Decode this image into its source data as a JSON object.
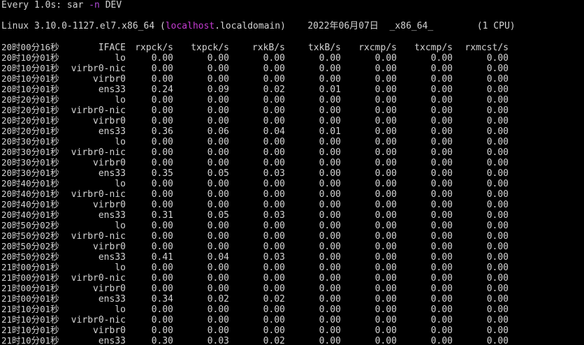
{
  "watch": {
    "prefix": "Every 1.0s: sar ",
    "flag": "-n",
    "suffix": " DEV"
  },
  "sysinfo": {
    "prefix": "Linux 3.10.0-1127.el7.x86_64 (",
    "host": "localhost",
    "suffix": ".localdomain)    2022年06月07日  _x86_64_        (1 CPU)"
  },
  "columns": [
    "20时00分16秒",
    "IFACE",
    "rxpck/s",
    "txpck/s",
    "rxkB/s",
    "txkB/s",
    "rxcmp/s",
    "txcmp/s",
    "rxmcst/s"
  ],
  "rows": [
    {
      "time": "20时10分01秒",
      "iface": "lo",
      "values": [
        "0.00",
        "0.00",
        "0.00",
        "0.00",
        "0.00",
        "0.00",
        "0.00"
      ]
    },
    {
      "time": "20时10分01秒",
      "iface": "virbr0-nic",
      "values": [
        "0.00",
        "0.00",
        "0.00",
        "0.00",
        "0.00",
        "0.00",
        "0.00"
      ]
    },
    {
      "time": "20时10分01秒",
      "iface": "virbr0",
      "values": [
        "0.00",
        "0.00",
        "0.00",
        "0.00",
        "0.00",
        "0.00",
        "0.00"
      ]
    },
    {
      "time": "20时10分01秒",
      "iface": "ens33",
      "values": [
        "0.24",
        "0.09",
        "0.02",
        "0.01",
        "0.00",
        "0.00",
        "0.00"
      ]
    },
    {
      "time": "20时20分01秒",
      "iface": "lo",
      "values": [
        "0.00",
        "0.00",
        "0.00",
        "0.00",
        "0.00",
        "0.00",
        "0.00"
      ]
    },
    {
      "time": "20时20分01秒",
      "iface": "virbr0-nic",
      "values": [
        "0.00",
        "0.00",
        "0.00",
        "0.00",
        "0.00",
        "0.00",
        "0.00"
      ]
    },
    {
      "time": "20时20分01秒",
      "iface": "virbr0",
      "values": [
        "0.00",
        "0.00",
        "0.00",
        "0.00",
        "0.00",
        "0.00",
        "0.00"
      ]
    },
    {
      "time": "20时20分01秒",
      "iface": "ens33",
      "values": [
        "0.36",
        "0.06",
        "0.04",
        "0.01",
        "0.00",
        "0.00",
        "0.00"
      ]
    },
    {
      "time": "20时30分01秒",
      "iface": "lo",
      "values": [
        "0.00",
        "0.00",
        "0.00",
        "0.00",
        "0.00",
        "0.00",
        "0.00"
      ]
    },
    {
      "time": "20时30分01秒",
      "iface": "virbr0-nic",
      "values": [
        "0.00",
        "0.00",
        "0.00",
        "0.00",
        "0.00",
        "0.00",
        "0.00"
      ]
    },
    {
      "time": "20时30分01秒",
      "iface": "virbr0",
      "values": [
        "0.00",
        "0.00",
        "0.00",
        "0.00",
        "0.00",
        "0.00",
        "0.00"
      ]
    },
    {
      "time": "20时30分01秒",
      "iface": "ens33",
      "values": [
        "0.35",
        "0.05",
        "0.03",
        "0.00",
        "0.00",
        "0.00",
        "0.00"
      ]
    },
    {
      "time": "20时40分01秒",
      "iface": "lo",
      "values": [
        "0.00",
        "0.00",
        "0.00",
        "0.00",
        "0.00",
        "0.00",
        "0.00"
      ]
    },
    {
      "time": "20时40分01秒",
      "iface": "virbr0-nic",
      "values": [
        "0.00",
        "0.00",
        "0.00",
        "0.00",
        "0.00",
        "0.00",
        "0.00"
      ]
    },
    {
      "time": "20时40分01秒",
      "iface": "virbr0",
      "values": [
        "0.00",
        "0.00",
        "0.00",
        "0.00",
        "0.00",
        "0.00",
        "0.00"
      ]
    },
    {
      "time": "20时40分01秒",
      "iface": "ens33",
      "values": [
        "0.31",
        "0.05",
        "0.03",
        "0.00",
        "0.00",
        "0.00",
        "0.00"
      ]
    },
    {
      "time": "20时50分02秒",
      "iface": "lo",
      "values": [
        "0.00",
        "0.00",
        "0.00",
        "0.00",
        "0.00",
        "0.00",
        "0.00"
      ]
    },
    {
      "time": "20时50分02秒",
      "iface": "virbr0-nic",
      "values": [
        "0.00",
        "0.00",
        "0.00",
        "0.00",
        "0.00",
        "0.00",
        "0.00"
      ]
    },
    {
      "time": "20时50分02秒",
      "iface": "virbr0",
      "values": [
        "0.00",
        "0.00",
        "0.00",
        "0.00",
        "0.00",
        "0.00",
        "0.00"
      ]
    },
    {
      "time": "20时50分02秒",
      "iface": "ens33",
      "values": [
        "0.41",
        "0.04",
        "0.03",
        "0.00",
        "0.00",
        "0.00",
        "0.00"
      ]
    },
    {
      "time": "21时00分01秒",
      "iface": "lo",
      "values": [
        "0.00",
        "0.00",
        "0.00",
        "0.00",
        "0.00",
        "0.00",
        "0.00"
      ]
    },
    {
      "time": "21时00分01秒",
      "iface": "virbr0-nic",
      "values": [
        "0.00",
        "0.00",
        "0.00",
        "0.00",
        "0.00",
        "0.00",
        "0.00"
      ]
    },
    {
      "time": "21时00分01秒",
      "iface": "virbr0",
      "values": [
        "0.00",
        "0.00",
        "0.00",
        "0.00",
        "0.00",
        "0.00",
        "0.00"
      ]
    },
    {
      "time": "21时00分01秒",
      "iface": "ens33",
      "values": [
        "0.34",
        "0.02",
        "0.02",
        "0.00",
        "0.00",
        "0.00",
        "0.00"
      ]
    },
    {
      "time": "21时10分01秒",
      "iface": "lo",
      "values": [
        "0.00",
        "0.00",
        "0.00",
        "0.00",
        "0.00",
        "0.00",
        "0.00"
      ]
    },
    {
      "time": "21时10分01秒",
      "iface": "virbr0-nic",
      "values": [
        "0.00",
        "0.00",
        "0.00",
        "0.00",
        "0.00",
        "0.00",
        "0.00"
      ]
    },
    {
      "time": "21时10分01秒",
      "iface": "virbr0",
      "values": [
        "0.00",
        "0.00",
        "0.00",
        "0.00",
        "0.00",
        "0.00",
        "0.00"
      ]
    },
    {
      "time": "21时10分01秒",
      "iface": "ens33",
      "values": [
        "0.30",
        "0.03",
        "0.02",
        "0.00",
        "0.00",
        "0.00",
        "0.00"
      ]
    }
  ],
  "colors": {
    "background": "#000000",
    "text": "#d4d4d4",
    "flag": "#b04ad8",
    "hostname": "#c43bd2"
  }
}
